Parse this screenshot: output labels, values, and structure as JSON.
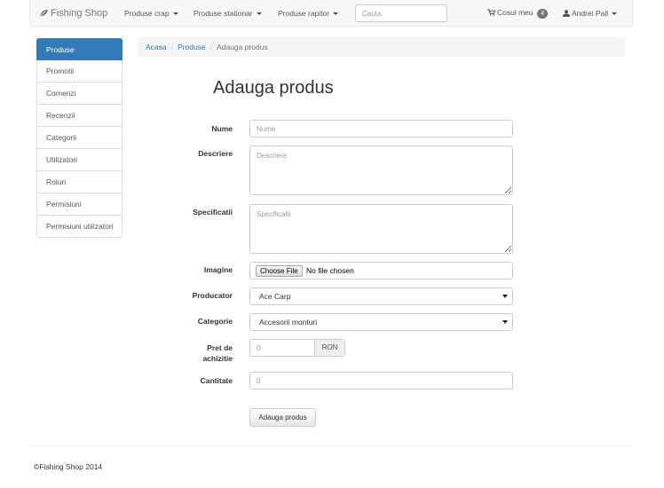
{
  "navbar": {
    "brand": "Fishing Shop",
    "menus": [
      {
        "label": "Produse crap"
      },
      {
        "label": "Produse stationar"
      },
      {
        "label": "Produse rapitor"
      }
    ],
    "search_placeholder": "Cauta",
    "cart_label": "Cosul meu",
    "cart_count": "4",
    "user_name": "Andrei Pall"
  },
  "sidebar": {
    "items": [
      {
        "label": "Produse",
        "active": true
      },
      {
        "label": "Promotii"
      },
      {
        "label": "Comenzi"
      },
      {
        "label": "Recenzii"
      },
      {
        "label": "Categorii"
      },
      {
        "label": "Utilizatori"
      },
      {
        "label": "Roluri"
      },
      {
        "label": "Permisiuni"
      },
      {
        "label": "Permisiuni utilizatori"
      }
    ]
  },
  "breadcrumb": {
    "items": [
      "Acasa",
      "Produse"
    ],
    "current": "Adauga produs",
    "separator": "/"
  },
  "page_title": "Adauga produs",
  "form": {
    "name": {
      "label": "Nume",
      "placeholder": "Nume",
      "value": ""
    },
    "description": {
      "label": "Descriere",
      "placeholder": "Descriere"
    },
    "specifications": {
      "label": "Specificatii",
      "placeholder": "Specificatii"
    },
    "image": {
      "label": "Imagine",
      "button": "Choose File",
      "status": "No file chosen"
    },
    "producer": {
      "label": "Producator",
      "selected": "Ace Carp"
    },
    "category": {
      "label": "Categorie",
      "selected": "Accesorii monturi"
    },
    "price": {
      "label_line1": "Pret de",
      "label_line2": "achizitie",
      "placeholder": "0",
      "currency": "RON"
    },
    "quantity": {
      "label": "Cantitate",
      "placeholder": "0"
    },
    "submit_label": "Adauga produs"
  },
  "footer": {
    "text": "©Fishing Shop 2014"
  },
  "colors": {
    "primary": "#337ab7",
    "navbar_bg": "#f8f8f8",
    "breadcrumb_bg": "#f5f5f5"
  }
}
